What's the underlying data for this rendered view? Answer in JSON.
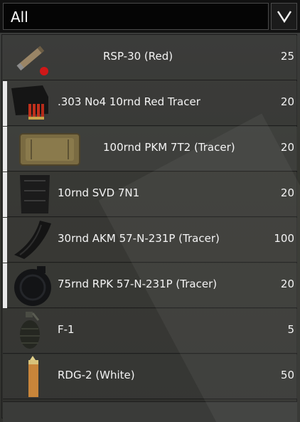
{
  "filter": {
    "selected": "All"
  },
  "colors": {
    "accent": "#e9e9e9",
    "background": "#2b2c2b",
    "text": "#f4f4f4"
  },
  "items": [
    {
      "name": "RSP-30 (Red)",
      "qty": "25",
      "icon": "flare-icon",
      "accent": false
    },
    {
      "name": ".303 No4 10rnd Red Tracer",
      "qty": "20",
      "icon": "ammo-box-icon",
      "accent": true
    },
    {
      "name": "100rnd PKM 7T2 (Tracer)",
      "qty": "20",
      "icon": "ammo-pouch-icon",
      "accent": true
    },
    {
      "name": "10rnd SVD 7N1",
      "qty": "20",
      "icon": "magazine-icon",
      "accent": true
    },
    {
      "name": "30rnd AKM 57-N-231P (Tracer)",
      "qty": "100",
      "icon": "curved-magazine-icon",
      "accent": true
    },
    {
      "name": "75rnd RPK 57-N-231P (Tracer)",
      "qty": "20",
      "icon": "drum-magazine-icon",
      "accent": true
    },
    {
      "name": "F-1",
      "qty": "5",
      "icon": "grenade-icon",
      "accent": false
    },
    {
      "name": "RDG-2 (White)",
      "qty": "50",
      "icon": "smoke-grenade-icon",
      "accent": false
    }
  ]
}
